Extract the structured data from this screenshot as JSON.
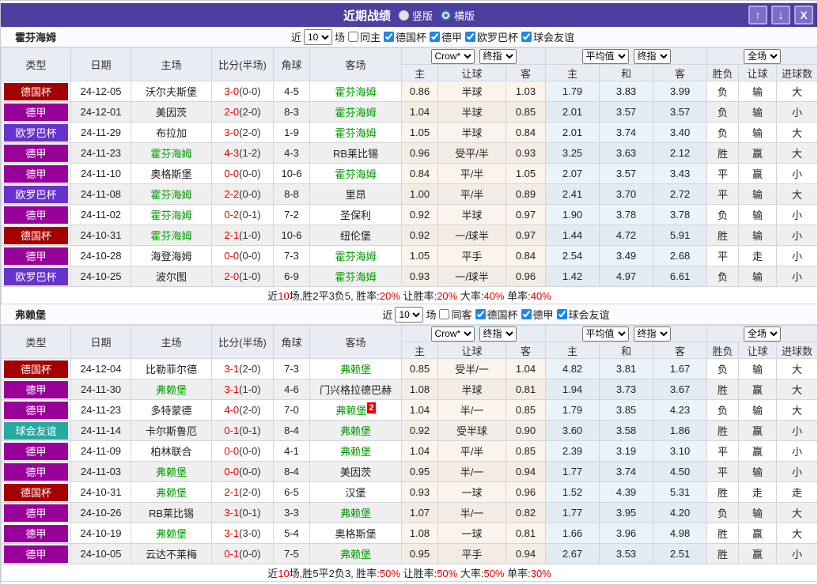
{
  "titlebar": {
    "title": "近期战绩",
    "radios": [
      {
        "label": "竖版",
        "selected": false
      },
      {
        "label": "横版",
        "selected": true
      }
    ],
    "up_icon": "↑",
    "down_icon": "↓",
    "close_icon": "X"
  },
  "type_colors": {
    "德国杯": "#A40000",
    "德甲": "#990099",
    "欧罗巴杯": "#6633CC",
    "球会友谊": "#28A8A0"
  },
  "result_colors": {
    "red": "#D60000",
    "blue": "#1515D0",
    "green": "#009900"
  },
  "header": {
    "match_cols": [
      "类型",
      "日期",
      "主场",
      "比分(半场)",
      "角球",
      "客场"
    ],
    "handicap_dropdowns": [
      "Crow*",
      "终指"
    ],
    "euro_dropdowns": [
      "平均值",
      "终指"
    ],
    "scope_dropdown": "全场",
    "sub_cols": [
      "主",
      "让球",
      "客",
      "主",
      "和",
      "客",
      "胜负",
      "让球",
      "进球数"
    ]
  },
  "sections": [
    {
      "team": "霍芬海姆",
      "filter": {
        "near_label": "近",
        "count": "10",
        "games_label": "场",
        "venue": {
          "label": "同主",
          "checked": false
        },
        "comps": [
          {
            "label": "德国杯",
            "checked": true
          },
          {
            "label": "德甲",
            "checked": true
          },
          {
            "label": "欧罗巴杯",
            "checked": true
          },
          {
            "label": "球会友谊",
            "checked": true
          }
        ]
      },
      "rows": [
        {
          "type": "德国杯",
          "date": "24-12-05",
          "home": "沃尔夫斯堡",
          "home_focus": false,
          "score": "3-0",
          "half": "(0-0)",
          "corner": "4-5",
          "away": "霍芬海姆",
          "away_focus": true,
          "away_badge": "",
          "ah": [
            "0.86",
            "半球",
            "1.03"
          ],
          "eu": [
            "1.79",
            "3.83",
            "3.99"
          ],
          "res": [
            [
              "负",
              "blue"
            ],
            [
              "输",
              "blue"
            ],
            [
              "大",
              "red"
            ]
          ]
        },
        {
          "type": "德甲",
          "date": "24-12-01",
          "home": "美因茨",
          "home_focus": false,
          "score": "2-0",
          "half": "(2-0)",
          "corner": "8-3",
          "away": "霍芬海姆",
          "away_focus": true,
          "away_badge": "",
          "ah": [
            "1.04",
            "半球",
            "0.85"
          ],
          "eu": [
            "2.01",
            "3.57",
            "3.57"
          ],
          "res": [
            [
              "负",
              "blue"
            ],
            [
              "输",
              "blue"
            ],
            [
              "小",
              "blue"
            ]
          ]
        },
        {
          "type": "欧罗巴杯",
          "date": "24-11-29",
          "home": "布拉加",
          "home_focus": false,
          "score": "3-0",
          "half": "(2-0)",
          "corner": "1-9",
          "away": "霍芬海姆",
          "away_focus": true,
          "away_badge": "",
          "ah": [
            "1.05",
            "半球",
            "0.84"
          ],
          "eu": [
            "2.01",
            "3.74",
            "3.40"
          ],
          "res": [
            [
              "负",
              "blue"
            ],
            [
              "输",
              "blue"
            ],
            [
              "大",
              "red"
            ]
          ]
        },
        {
          "type": "德甲",
          "date": "24-11-23",
          "home": "霍芬海姆",
          "home_focus": true,
          "score": "4-3",
          "half": "(1-2)",
          "corner": "4-3",
          "away": "RB莱比锡",
          "away_focus": false,
          "away_badge": "",
          "ah": [
            "0.96",
            "受平/半",
            "0.93"
          ],
          "eu": [
            "3.25",
            "3.63",
            "2.12"
          ],
          "res": [
            [
              "胜",
              "red"
            ],
            [
              "赢",
              "red"
            ],
            [
              "大",
              "red"
            ]
          ]
        },
        {
          "type": "德甲",
          "date": "24-11-10",
          "home": "奥格斯堡",
          "home_focus": false,
          "score": "0-0",
          "half": "(0-0)",
          "corner": "10-6",
          "away": "霍芬海姆",
          "away_focus": true,
          "away_badge": "",
          "ah": [
            "0.84",
            "平/半",
            "1.05"
          ],
          "eu": [
            "2.07",
            "3.57",
            "3.43"
          ],
          "res": [
            [
              "平",
              "green"
            ],
            [
              "赢",
              "red"
            ],
            [
              "小",
              "blue"
            ]
          ]
        },
        {
          "type": "欧罗巴杯",
          "date": "24-11-08",
          "home": "霍芬海姆",
          "home_focus": true,
          "score": "2-2",
          "half": "(0-0)",
          "corner": "8-8",
          "away": "里昂",
          "away_focus": false,
          "away_badge": "",
          "ah": [
            "1.00",
            "平/半",
            "0.89"
          ],
          "eu": [
            "2.41",
            "3.70",
            "2.72"
          ],
          "res": [
            [
              "平",
              "green"
            ],
            [
              "输",
              "blue"
            ],
            [
              "大",
              "red"
            ]
          ]
        },
        {
          "type": "德甲",
          "date": "24-11-02",
          "home": "霍芬海姆",
          "home_focus": true,
          "score": "0-2",
          "half": "(0-1)",
          "corner": "7-2",
          "away": "圣保利",
          "away_focus": false,
          "away_badge": "",
          "ah": [
            "0.92",
            "半球",
            "0.97"
          ],
          "eu": [
            "1.90",
            "3.78",
            "3.78"
          ],
          "res": [
            [
              "负",
              "blue"
            ],
            [
              "输",
              "blue"
            ],
            [
              "小",
              "blue"
            ]
          ]
        },
        {
          "type": "德国杯",
          "date": "24-10-31",
          "home": "霍芬海姆",
          "home_focus": true,
          "score": "2-1",
          "half": "(1-0)",
          "corner": "10-6",
          "away": "纽伦堡",
          "away_focus": false,
          "away_badge": "",
          "ah": [
            "0.92",
            "一/球半",
            "0.97"
          ],
          "eu": [
            "1.44",
            "4.72",
            "5.91"
          ],
          "res": [
            [
              "胜",
              "red"
            ],
            [
              "输",
              "blue"
            ],
            [
              "小",
              "blue"
            ]
          ]
        },
        {
          "type": "德甲",
          "date": "24-10-28",
          "home": "海登海姆",
          "home_focus": false,
          "score": "0-0",
          "half": "(0-0)",
          "corner": "7-3",
          "away": "霍芬海姆",
          "away_focus": true,
          "away_badge": "",
          "ah": [
            "1.05",
            "平手",
            "0.84"
          ],
          "eu": [
            "2.54",
            "3.49",
            "2.68"
          ],
          "res": [
            [
              "平",
              "green"
            ],
            [
              "走",
              "green"
            ],
            [
              "小",
              "blue"
            ]
          ]
        },
        {
          "type": "欧罗巴杯",
          "date": "24-10-25",
          "home": "波尔图",
          "home_focus": false,
          "score": "2-0",
          "half": "(1-0)",
          "corner": "6-9",
          "away": "霍芬海姆",
          "away_focus": true,
          "away_badge": "",
          "ah": [
            "0.93",
            "一/球半",
            "0.96"
          ],
          "eu": [
            "1.42",
            "4.97",
            "6.61"
          ],
          "res": [
            [
              "负",
              "blue"
            ],
            [
              "输",
              "blue"
            ],
            [
              "小",
              "blue"
            ]
          ]
        }
      ],
      "summary": [
        [
          "近",
          "k"
        ],
        [
          "10",
          "r"
        ],
        [
          "场,胜2平3负5, 胜率:",
          "k"
        ],
        [
          "20%",
          "r"
        ],
        [
          " 让胜率:",
          "k"
        ],
        [
          "20%",
          "r"
        ],
        [
          " 大率:",
          "k"
        ],
        [
          "40%",
          "r"
        ],
        [
          " 单率:",
          "k"
        ],
        [
          "40%",
          "r"
        ]
      ]
    },
    {
      "team": "弗赖堡",
      "filter": {
        "near_label": "近",
        "count": "10",
        "games_label": "场",
        "venue": {
          "label": "同客",
          "checked": false
        },
        "comps": [
          {
            "label": "德国杯",
            "checked": true
          },
          {
            "label": "德甲",
            "checked": true
          },
          {
            "label": "球会友谊",
            "checked": true
          }
        ]
      },
      "rows": [
        {
          "type": "德国杯",
          "date": "24-12-04",
          "home": "比勒菲尔德",
          "home_focus": false,
          "score": "3-1",
          "half": "(2-0)",
          "corner": "7-3",
          "away": "弗赖堡",
          "away_focus": true,
          "away_badge": "",
          "ah": [
            "0.85",
            "受半/一",
            "1.04"
          ],
          "eu": [
            "4.82",
            "3.81",
            "1.67"
          ],
          "res": [
            [
              "负",
              "blue"
            ],
            [
              "输",
              "blue"
            ],
            [
              "大",
              "red"
            ]
          ]
        },
        {
          "type": "德甲",
          "date": "24-11-30",
          "home": "弗赖堡",
          "home_focus": true,
          "score": "3-1",
          "half": "(1-0)",
          "corner": "4-6",
          "away": "门兴格拉德巴赫",
          "away_focus": false,
          "away_badge": "",
          "ah": [
            "1.08",
            "半球",
            "0.81"
          ],
          "eu": [
            "1.94",
            "3.73",
            "3.67"
          ],
          "res": [
            [
              "胜",
              "red"
            ],
            [
              "赢",
              "red"
            ],
            [
              "大",
              "red"
            ]
          ]
        },
        {
          "type": "德甲",
          "date": "24-11-23",
          "home": "多特蒙德",
          "home_focus": false,
          "score": "4-0",
          "half": "(2-0)",
          "corner": "7-0",
          "away": "弗赖堡",
          "away_focus": true,
          "away_badge": "2",
          "ah": [
            "1.04",
            "半/一",
            "0.85"
          ],
          "eu": [
            "1.79",
            "3.85",
            "4.23"
          ],
          "res": [
            [
              "负",
              "blue"
            ],
            [
              "输",
              "blue"
            ],
            [
              "大",
              "red"
            ]
          ]
        },
        {
          "type": "球会友谊",
          "date": "24-11-14",
          "home": "卡尔斯鲁厄",
          "home_focus": false,
          "score": "0-1",
          "half": "(0-1)",
          "corner": "8-4",
          "away": "弗赖堡",
          "away_focus": true,
          "away_badge": "",
          "ah": [
            "0.92",
            "受半球",
            "0.90"
          ],
          "eu": [
            "3.60",
            "3.58",
            "1.86"
          ],
          "res": [
            [
              "胜",
              "red"
            ],
            [
              "赢",
              "red"
            ],
            [
              "小",
              "blue"
            ]
          ]
        },
        {
          "type": "德甲",
          "date": "24-11-09",
          "home": "柏林联合",
          "home_focus": false,
          "score": "0-0",
          "half": "(0-0)",
          "corner": "4-1",
          "away": "弗赖堡",
          "away_focus": true,
          "away_badge": "",
          "ah": [
            "1.04",
            "平/半",
            "0.85"
          ],
          "eu": [
            "2.39",
            "3.19",
            "3.10"
          ],
          "res": [
            [
              "平",
              "green"
            ],
            [
              "赢",
              "red"
            ],
            [
              "小",
              "blue"
            ]
          ]
        },
        {
          "type": "德甲",
          "date": "24-11-03",
          "home": "弗赖堡",
          "home_focus": true,
          "score": "0-0",
          "half": "(0-0)",
          "corner": "8-4",
          "away": "美因茨",
          "away_focus": false,
          "away_badge": "",
          "ah": [
            "0.95",
            "半/一",
            "0.94"
          ],
          "eu": [
            "1.77",
            "3.74",
            "4.50"
          ],
          "res": [
            [
              "平",
              "green"
            ],
            [
              "输",
              "blue"
            ],
            [
              "小",
              "blue"
            ]
          ]
        },
        {
          "type": "德国杯",
          "date": "24-10-31",
          "home": "弗赖堡",
          "home_focus": true,
          "score": "2-1",
          "half": "(2-0)",
          "corner": "6-5",
          "away": "汉堡",
          "away_focus": false,
          "away_badge": "",
          "ah": [
            "0.93",
            "一球",
            "0.96"
          ],
          "eu": [
            "1.52",
            "4.39",
            "5.31"
          ],
          "res": [
            [
              "胜",
              "red"
            ],
            [
              "走",
              "green"
            ],
            [
              "走",
              "green"
            ]
          ]
        },
        {
          "type": "德甲",
          "date": "24-10-26",
          "home": "RB莱比锡",
          "home_focus": false,
          "score": "3-1",
          "half": "(0-1)",
          "corner": "3-3",
          "away": "弗赖堡",
          "away_focus": true,
          "away_badge": "",
          "ah": [
            "1.07",
            "半/一",
            "0.82"
          ],
          "eu": [
            "1.77",
            "3.95",
            "4.20"
          ],
          "res": [
            [
              "负",
              "blue"
            ],
            [
              "输",
              "blue"
            ],
            [
              "大",
              "red"
            ]
          ]
        },
        {
          "type": "德甲",
          "date": "24-10-19",
          "home": "弗赖堡",
          "home_focus": true,
          "score": "3-1",
          "half": "(3-0)",
          "corner": "5-4",
          "away": "奥格斯堡",
          "away_focus": false,
          "away_badge": "",
          "ah": [
            "1.08",
            "一球",
            "0.81"
          ],
          "eu": [
            "1.66",
            "3.96",
            "4.98"
          ],
          "res": [
            [
              "胜",
              "red"
            ],
            [
              "赢",
              "red"
            ],
            [
              "大",
              "red"
            ]
          ]
        },
        {
          "type": "德甲",
          "date": "24-10-05",
          "home": "云达不莱梅",
          "home_focus": false,
          "score": "0-1",
          "half": "(0-0)",
          "corner": "7-5",
          "away": "弗赖堡",
          "away_focus": true,
          "away_badge": "",
          "ah": [
            "0.95",
            "平手",
            "0.94"
          ],
          "eu": [
            "2.67",
            "3.53",
            "2.51"
          ],
          "res": [
            [
              "胜",
              "red"
            ],
            [
              "赢",
              "red"
            ],
            [
              "小",
              "blue"
            ]
          ]
        }
      ],
      "summary": [
        [
          "近",
          "k"
        ],
        [
          "10",
          "r"
        ],
        [
          "场,胜5平2负3, 胜率:",
          "k"
        ],
        [
          "50%",
          "r"
        ],
        [
          " 让胜率:",
          "k"
        ],
        [
          "50%",
          "r"
        ],
        [
          " 大率:",
          "k"
        ],
        [
          "50%",
          "r"
        ],
        [
          " 单率:",
          "k"
        ],
        [
          "30%",
          "r"
        ]
      ]
    }
  ]
}
